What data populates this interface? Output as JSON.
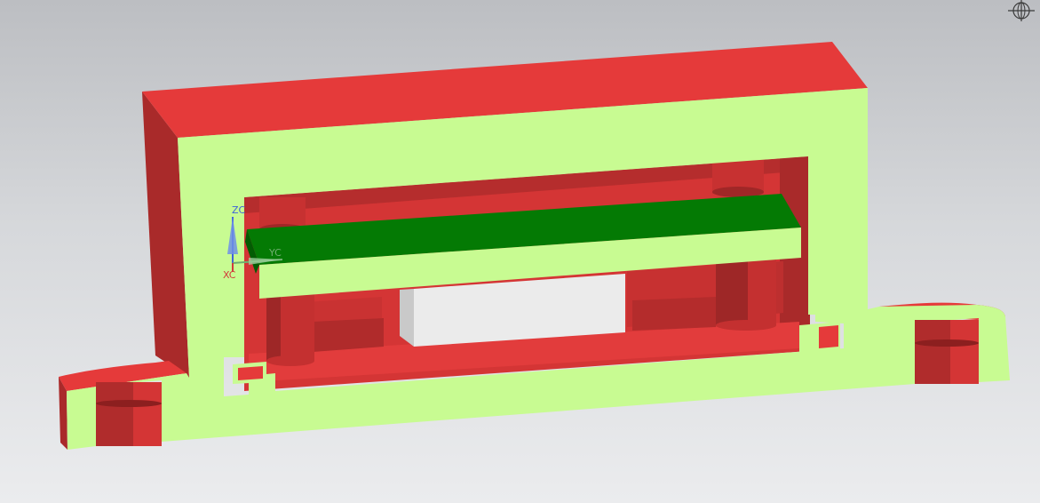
{
  "viewport": {
    "background_top": "#bcbec2",
    "background_bottom": "#ebecee"
  },
  "colors": {
    "section_face": "#c8fb92",
    "body_red": "#e53a3a",
    "body_red_dark": "#a92a2a",
    "body_red_darker": "#8c1f1f",
    "pcb_green": "#047a04",
    "pcb_green_dark": "#035c03",
    "component_white": "#ebebeb",
    "component_shade": "#c9c9c9"
  },
  "axes": {
    "z_label": "ZC",
    "y_label": "YC",
    "x_label": "XC",
    "z_color": "#3f63d8",
    "y_color": "#6fae6f",
    "x_color": "#d23b3b"
  },
  "icons": {
    "view_orientation": "crosshair-globe-icon"
  }
}
